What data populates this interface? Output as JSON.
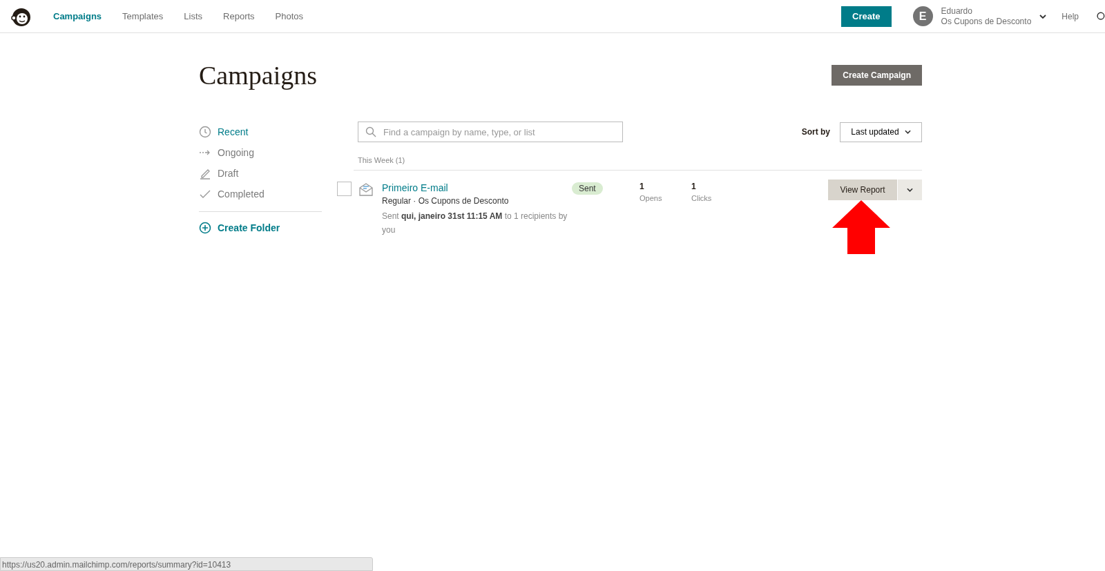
{
  "nav": {
    "items": [
      {
        "label": "Campaigns",
        "selected": true
      },
      {
        "label": "Templates",
        "selected": false
      },
      {
        "label": "Lists",
        "selected": false
      },
      {
        "label": "Reports",
        "selected": false
      },
      {
        "label": "Photos",
        "selected": false
      }
    ],
    "create_button": "Create",
    "account": {
      "initial": "E",
      "name": "Eduardo",
      "org": "Os Cupons de Desconto"
    },
    "help": "Help"
  },
  "page": {
    "title": "Campaigns",
    "create_campaign": "Create Campaign"
  },
  "sidebar": {
    "items": [
      {
        "label": "Recent",
        "selected": true
      },
      {
        "label": "Ongoing",
        "selected": false
      },
      {
        "label": "Draft",
        "selected": false
      },
      {
        "label": "Completed",
        "selected": false
      }
    ],
    "create_folder": "Create Folder"
  },
  "search": {
    "placeholder": "Find a campaign by name, type, or list"
  },
  "sort": {
    "label": "Sort by",
    "value": "Last updated"
  },
  "group": {
    "heading": "This Week (1)"
  },
  "campaigns": [
    {
      "name": "Primeiro E-mail",
      "checked": false,
      "meta": "Regular · Os Cupons de Desconto",
      "detail": "Sent **qui, janeiro 31st 11:15 AM** to 1 recipients by you",
      "status": "Sent",
      "opens": "1",
      "opens_label": "Opens",
      "clicks": "1",
      "clicks_label": "Clicks",
      "action": "View Report"
    }
  ],
  "status_bar": {
    "url": "https://us20.admin.mailchimp.com/reports/summary?id=10413"
  }
}
